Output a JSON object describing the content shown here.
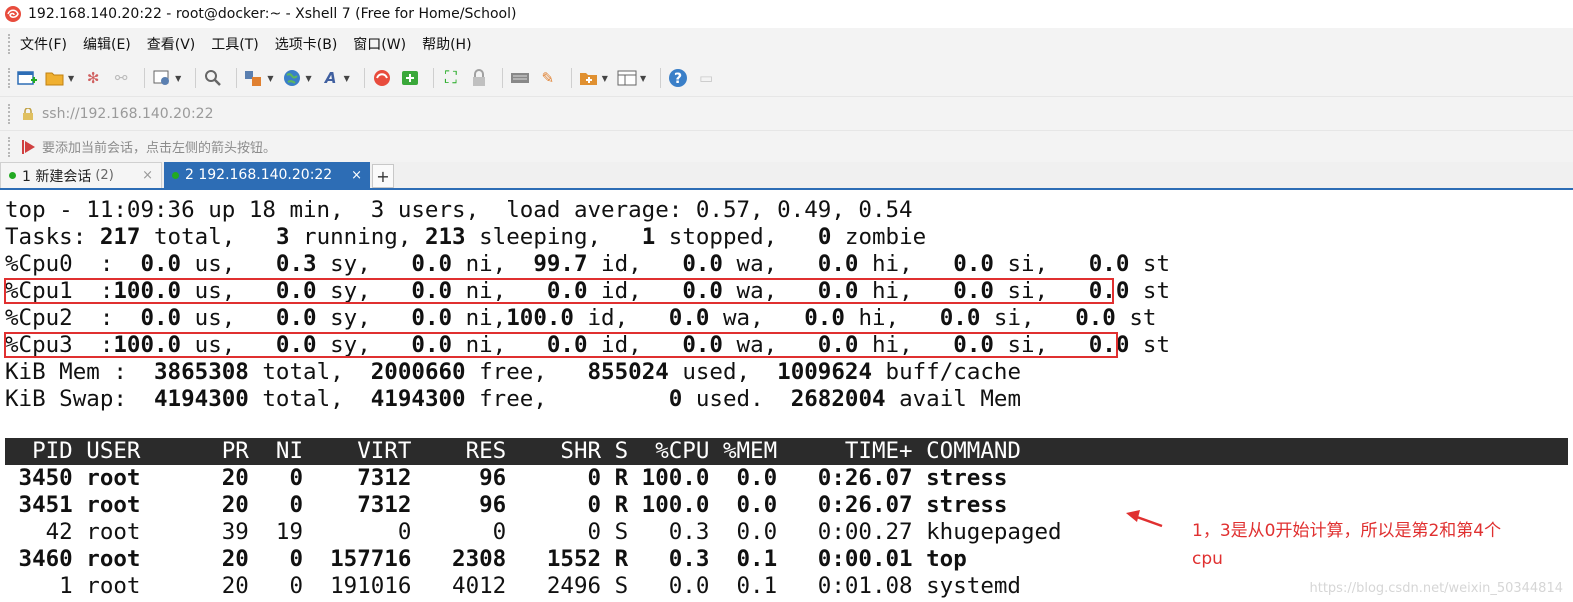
{
  "window": {
    "title": "192.168.140.20:22 - root@docker:~ - Xshell 7 (Free for Home/School)"
  },
  "menu": [
    "文件(F)",
    "编辑(E)",
    "查看(V)",
    "工具(T)",
    "选项卡(B)",
    "窗口(W)",
    "帮助(H)"
  ],
  "address": "ssh://192.168.140.20:22",
  "hint": "要添加当前会话，点击左侧的箭头按钮。",
  "tabs": [
    {
      "label": "1 新建会话",
      "count": "(2)",
      "close": "×"
    },
    {
      "label": "2 192.168.140.20:22",
      "close": "×"
    }
  ],
  "tab_add": "+",
  "terminal": {
    "line1": "top - 11:09:36 up 18 min,  3 users,  load average: 0.57, 0.49, 0.54",
    "tasks": {
      "label": "Tasks:",
      "total": "217",
      "running": "3",
      "sleeping": "213",
      "stopped": "1",
      "zombie": "0"
    },
    "cpus": [
      {
        "name": "%Cpu0  :",
        "us": "  0.0",
        "sy": "  0.3",
        "ni": "  0.0",
        "id": " 99.7",
        "wa": "  0.0",
        "hi": "  0.0",
        "si": "  0.0",
        "st": "  0.0"
      },
      {
        "name": "%Cpu1  :",
        "us": "100.0",
        "sy": "  0.0",
        "ni": "  0.0",
        "id": "  0.0",
        "wa": "  0.0",
        "hi": "  0.0",
        "si": "  0.0",
        "st": "  0.0"
      },
      {
        "name": "%Cpu2  :",
        "us": "  0.0",
        "sy": "  0.0",
        "ni": "  0.0",
        "id": "100.0",
        "wa": "  0.0",
        "hi": "  0.0",
        "si": "  0.0",
        "st": "  0.0"
      },
      {
        "name": "%Cpu3  :",
        "us": "100.0",
        "sy": "  0.0",
        "ni": "  0.0",
        "id": "  0.0",
        "wa": "  0.0",
        "hi": "  0.0",
        "si": "  0.0",
        "st": "  0.0"
      }
    ],
    "mem": {
      "label": "KiB Mem :",
      "total": "3865308",
      "free": "2000660",
      "used": "855024",
      "buff_cache": "1009624"
    },
    "swap": {
      "label": "KiB Swap:",
      "total": "4194300",
      "free": "4194300",
      "used": "0",
      "avail": "2682004"
    },
    "columns": "  PID USER      PR  NI    VIRT    RES    SHR S  %CPU %MEM     TIME+ COMMAND",
    "processes": [
      {
        "text": " 3450 root      20   0    7312     96      0 R 100.0  0.0   0:26.07 stress",
        "bold": true
      },
      {
        "text": " 3451 root      20   0    7312     96      0 R 100.0  0.0   0:26.07 stress",
        "bold": true
      },
      {
        "text": "   42 root      39  19       0      0      0 S   0.3  0.0   0:00.27 khugepaged",
        "bold": false
      },
      {
        "text": " 3460 root      20   0  157716   2308   1552 R   0.3  0.1   0:00.01 top",
        "bold": true
      },
      {
        "text": "    1 root      20   0  191016   4012   2496 S   0.0  0.1   0:01.08 systemd",
        "bold": false
      }
    ]
  },
  "annotation": {
    "line1": "1，3是从0开始计算，所以是第2和第4个",
    "line2": "cpu"
  },
  "watermark": "https://blog.csdn.net/weixin_50344814",
  "colors": {
    "tab_active": "#2d6db5",
    "highlight": "#e03030",
    "header_bg": "#2b2b2b"
  }
}
